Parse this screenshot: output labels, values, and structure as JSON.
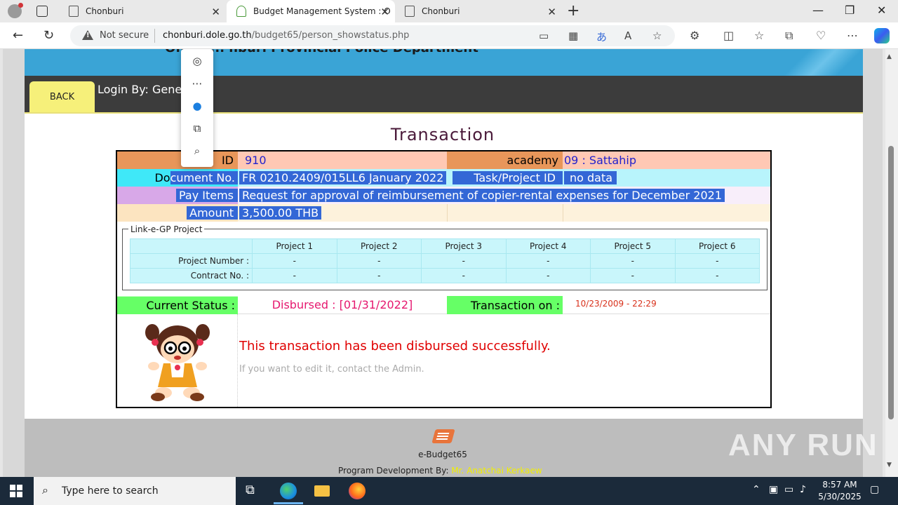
{
  "browser": {
    "tabs": [
      {
        "title": "Chonburi"
      },
      {
        "title": "Budget Management System : O"
      },
      {
        "title": "Chonburi"
      }
    ],
    "address": {
      "security_label": "Not secure",
      "host": "chonburi.dole.go.th",
      "path": "/budget65/person_showstatus.php"
    }
  },
  "site": {
    "header_title": "Office ... nburi Provincial Police Department",
    "back_label": "BACK",
    "login_by": "Login By: Gene"
  },
  "transaction": {
    "title": "Transaction",
    "id_label": "ID",
    "id_value": "910",
    "academy_label": "academy",
    "academy_value": "09 : Sattahip",
    "doc_label_prefix": "Do",
    "doc_label_selected": "cument No.",
    "doc_value": "FR 0210.2409/015LL6 January 2022",
    "task_label": "Task/Project ID",
    "task_value": "no data",
    "payitems_label": "Pay Items",
    "payitems_value": "Request for approval of reimbursement of copier-rental expenses for December 2021",
    "amount_label": "Amount",
    "amount_value": "3,500.00 THB",
    "egp": {
      "legend": "Link-e-GP Project",
      "headers": [
        "Project 1",
        "Project 2",
        "Project 3",
        "Project 4",
        "Project 5",
        "Project 6"
      ],
      "project_number_label": "Project Number :",
      "contract_no_label": "Contract No. :",
      "project_numbers": [
        "-",
        "-",
        "-",
        "-",
        "-",
        "-"
      ],
      "contract_numbers": [
        "-",
        "-",
        "-",
        "-",
        "-",
        "-"
      ]
    },
    "status_label": "Current Status :",
    "status_value": "Disbursed : [01/31/2022]",
    "transaction_on_label": "Transaction on :",
    "transaction_on_value": "10/23/2009 - 22:29",
    "message": "This transaction has been disbursed successfully.",
    "sub_message": "If you want to edit it, contact the Admin."
  },
  "footer": {
    "app_name": "e-Budget65",
    "dev_prefix": "Program Development By:",
    "dev_name": "Mr. Anatchai Kerkaew"
  },
  "watermark": "ANY RUN",
  "taskbar": {
    "search_placeholder": "Type here to search",
    "time": "8:57 AM",
    "date": "5/30/2025"
  },
  "colors": {
    "header_blue": "#3aa4d6",
    "id_row_label": "#e8965a",
    "id_row_value": "#ffc8b4",
    "doc_row_label": "#3fe8f8",
    "doc_row_value": "#b8f4fc",
    "pay_row_label": "#d8a8e8",
    "pay_row_value": "#f8eefa",
    "amount_row_label": "#fce4c0",
    "amount_row_value": "#fdf2dc",
    "status_label": "#66ff66",
    "status_value": "#e6186f",
    "message_red": "#e00000",
    "selection": "#3367d6"
  }
}
